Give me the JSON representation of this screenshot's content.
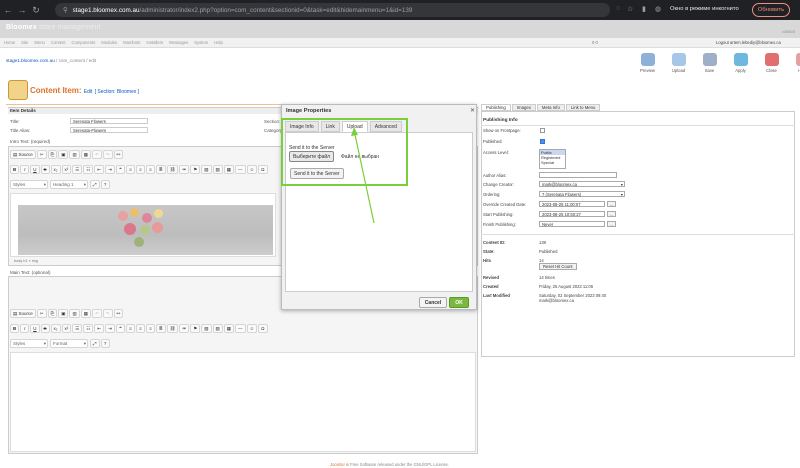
{
  "browser": {
    "url_domain": "stage1.bloomex.com.au",
    "url_rest": "/administrator/index2.php?option=com_content&sectionid=0&task=edit&hidemainmenu=1&id=139",
    "incognito": "Окно в режиме инкогнито",
    "update": "Обновить"
  },
  "header": {
    "brand": "Bloomex",
    "brand_sub": " store management",
    "version": "v2006 B"
  },
  "menu": [
    "Home",
    "Site",
    "Menu",
    "Content",
    "Components",
    "Modules",
    "Mambots",
    "Installers",
    "Messages",
    "System",
    "Help"
  ],
  "menu_nums": "0    0",
  "logout": "Logout artem.lebediy@bloomex.ca",
  "breadcrumb": {
    "site": "stage1.bloomex.com.au",
    "path": " / com_content / edit"
  },
  "toolbar": [
    {
      "label": "Preview",
      "color": "#8db1d8"
    },
    {
      "label": "Upload",
      "color": "#a7c7e8"
    },
    {
      "label": "Save",
      "color": "#9db0c8"
    },
    {
      "label": "Apply",
      "color": "#6eb8e0"
    },
    {
      "label": "Close",
      "color": "#e07070"
    },
    {
      "label": "Help",
      "color": "#e6a0a0"
    }
  ],
  "page": {
    "title": "Content Item:",
    "mode": "Edit",
    "section": "[ Section: Bloomex ]"
  },
  "form": {
    "item_details": "Item Details",
    "title_label": "Title:",
    "title_value": "Serenata Flowers",
    "alias_label": "Title Alias:",
    "alias_value": "Serenata-Flowers",
    "section_label": "Section:",
    "category_label": "Category:",
    "intro_label": "Intro Text: (required)",
    "main_label": "Main Text: (optional)",
    "path": "body   h1   »   img",
    "source": "Source",
    "styles": "Styles",
    "heading": "Heading 1",
    "format": "Format"
  },
  "dialog": {
    "title": "Image Properties",
    "tabs": [
      "Image Info",
      "Link",
      "Upload",
      "Advanced"
    ],
    "active_tab": "Upload",
    "send_label": "Send it to the Server",
    "choose_file": "Выберите файл",
    "no_file": "Файл не выбран",
    "send_button": "Send it to the Server",
    "cancel": "Cancel",
    "ok": "OK"
  },
  "right": {
    "tabs": [
      "Publishing",
      "Images",
      "Meta Info",
      "Link to Menu"
    ],
    "heading": "Publishing Info",
    "frontpage_label": "Show on Frontpage:",
    "published_label": "Published:",
    "access_label": "Access Level:",
    "access_options": [
      "Public",
      "Registered",
      "Special"
    ],
    "author_alias_label": "Author Alias:",
    "creator_label": "Change Creator:",
    "creator_value": "mark@bloomex.ca",
    "ordering_label": "Ordering:",
    "ordering_value": "7 (Serenata Flowers)",
    "override_label": "Override Created Date:",
    "override_value": "2023-08-25 11:00:07",
    "start_label": "Start Publishing:",
    "start_value": "2023-08-25 10:50:27",
    "finish_label": "Finish Publishing:",
    "finish_value": "Never",
    "cal": "...",
    "content_id_label": "Content ID:",
    "content_id": "139",
    "state_label": "State:",
    "state": "Published",
    "hits_label": "Hits",
    "hits": "14",
    "reset_hits": "Reset Hit Count",
    "revised_label": "Revised",
    "revised": "14 times",
    "created_label": "Created",
    "created": "Friday, 25 August 2023 11:06",
    "modified_label": "Last Modified",
    "modified": "Saturday, 02 September 2023 09:40",
    "modified_by": "mark@bloomex.ca"
  },
  "footer": {
    "brand": "Joomla!",
    "text": " is Free Software released under the GNU/GPL License."
  },
  "colors": {
    "highlight": "#7ccf3c",
    "accent": "#e0712c"
  }
}
